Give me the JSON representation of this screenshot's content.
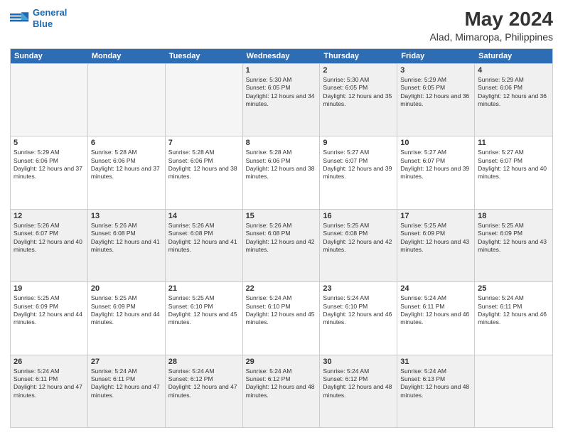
{
  "logo": {
    "line1": "General",
    "line2": "Blue"
  },
  "title": "May 2024",
  "subtitle": "Alad, Mimaropa, Philippines",
  "days_of_week": [
    "Sunday",
    "Monday",
    "Tuesday",
    "Wednesday",
    "Thursday",
    "Friday",
    "Saturday"
  ],
  "weeks": [
    [
      {
        "day": "",
        "empty": true
      },
      {
        "day": "",
        "empty": true
      },
      {
        "day": "",
        "empty": true
      },
      {
        "day": "1",
        "sunrise": "5:30 AM",
        "sunset": "6:05 PM",
        "daylight": "12 hours and 34 minutes."
      },
      {
        "day": "2",
        "sunrise": "5:30 AM",
        "sunset": "6:05 PM",
        "daylight": "12 hours and 35 minutes."
      },
      {
        "day": "3",
        "sunrise": "5:29 AM",
        "sunset": "6:05 PM",
        "daylight": "12 hours and 36 minutes."
      },
      {
        "day": "4",
        "sunrise": "5:29 AM",
        "sunset": "6:06 PM",
        "daylight": "12 hours and 36 minutes."
      }
    ],
    [
      {
        "day": "5",
        "sunrise": "5:29 AM",
        "sunset": "6:06 PM",
        "daylight": "12 hours and 37 minutes."
      },
      {
        "day": "6",
        "sunrise": "5:28 AM",
        "sunset": "6:06 PM",
        "daylight": "12 hours and 37 minutes."
      },
      {
        "day": "7",
        "sunrise": "5:28 AM",
        "sunset": "6:06 PM",
        "daylight": "12 hours and 38 minutes."
      },
      {
        "day": "8",
        "sunrise": "5:28 AM",
        "sunset": "6:06 PM",
        "daylight": "12 hours and 38 minutes."
      },
      {
        "day": "9",
        "sunrise": "5:27 AM",
        "sunset": "6:07 PM",
        "daylight": "12 hours and 39 minutes."
      },
      {
        "day": "10",
        "sunrise": "5:27 AM",
        "sunset": "6:07 PM",
        "daylight": "12 hours and 39 minutes."
      },
      {
        "day": "11",
        "sunrise": "5:27 AM",
        "sunset": "6:07 PM",
        "daylight": "12 hours and 40 minutes."
      }
    ],
    [
      {
        "day": "12",
        "sunrise": "5:26 AM",
        "sunset": "6:07 PM",
        "daylight": "12 hours and 40 minutes."
      },
      {
        "day": "13",
        "sunrise": "5:26 AM",
        "sunset": "6:08 PM",
        "daylight": "12 hours and 41 minutes."
      },
      {
        "day": "14",
        "sunrise": "5:26 AM",
        "sunset": "6:08 PM",
        "daylight": "12 hours and 41 minutes."
      },
      {
        "day": "15",
        "sunrise": "5:26 AM",
        "sunset": "6:08 PM",
        "daylight": "12 hours and 42 minutes."
      },
      {
        "day": "16",
        "sunrise": "5:25 AM",
        "sunset": "6:08 PM",
        "daylight": "12 hours and 42 minutes."
      },
      {
        "day": "17",
        "sunrise": "5:25 AM",
        "sunset": "6:09 PM",
        "daylight": "12 hours and 43 minutes."
      },
      {
        "day": "18",
        "sunrise": "5:25 AM",
        "sunset": "6:09 PM",
        "daylight": "12 hours and 43 minutes."
      }
    ],
    [
      {
        "day": "19",
        "sunrise": "5:25 AM",
        "sunset": "6:09 PM",
        "daylight": "12 hours and 44 minutes."
      },
      {
        "day": "20",
        "sunrise": "5:25 AM",
        "sunset": "6:09 PM",
        "daylight": "12 hours and 44 minutes."
      },
      {
        "day": "21",
        "sunrise": "5:25 AM",
        "sunset": "6:10 PM",
        "daylight": "12 hours and 45 minutes."
      },
      {
        "day": "22",
        "sunrise": "5:24 AM",
        "sunset": "6:10 PM",
        "daylight": "12 hours and 45 minutes."
      },
      {
        "day": "23",
        "sunrise": "5:24 AM",
        "sunset": "6:10 PM",
        "daylight": "12 hours and 46 minutes."
      },
      {
        "day": "24",
        "sunrise": "5:24 AM",
        "sunset": "6:11 PM",
        "daylight": "12 hours and 46 minutes."
      },
      {
        "day": "25",
        "sunrise": "5:24 AM",
        "sunset": "6:11 PM",
        "daylight": "12 hours and 46 minutes."
      }
    ],
    [
      {
        "day": "26",
        "sunrise": "5:24 AM",
        "sunset": "6:11 PM",
        "daylight": "12 hours and 47 minutes."
      },
      {
        "day": "27",
        "sunrise": "5:24 AM",
        "sunset": "6:11 PM",
        "daylight": "12 hours and 47 minutes."
      },
      {
        "day": "28",
        "sunrise": "5:24 AM",
        "sunset": "6:12 PM",
        "daylight": "12 hours and 47 minutes."
      },
      {
        "day": "29",
        "sunrise": "5:24 AM",
        "sunset": "6:12 PM",
        "daylight": "12 hours and 48 minutes."
      },
      {
        "day": "30",
        "sunrise": "5:24 AM",
        "sunset": "6:12 PM",
        "daylight": "12 hours and 48 minutes."
      },
      {
        "day": "31",
        "sunrise": "5:24 AM",
        "sunset": "6:13 PM",
        "daylight": "12 hours and 48 minutes."
      },
      {
        "day": "",
        "empty": true
      }
    ]
  ]
}
